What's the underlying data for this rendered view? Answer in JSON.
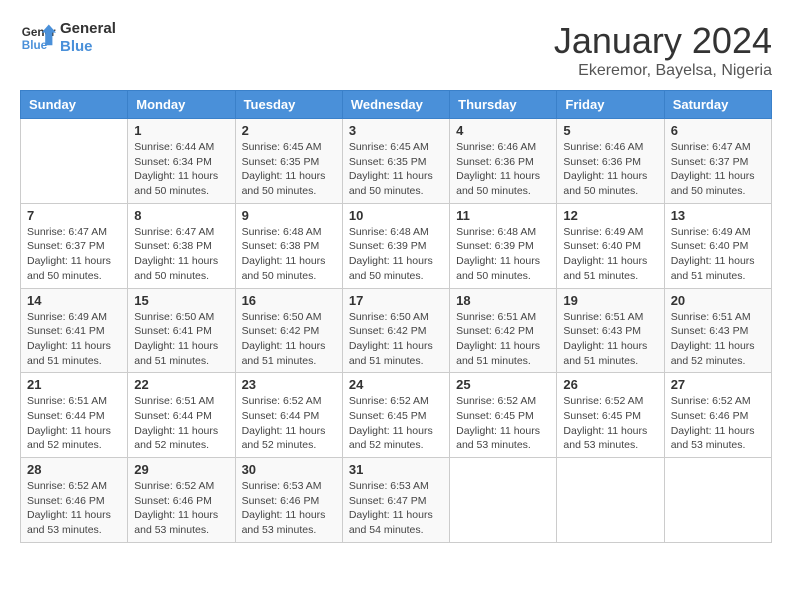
{
  "logo": {
    "text_general": "General",
    "text_blue": "Blue"
  },
  "title": "January 2024",
  "subtitle": "Ekeremor, Bayelsa, Nigeria",
  "days_header": [
    "Sunday",
    "Monday",
    "Tuesday",
    "Wednesday",
    "Thursday",
    "Friday",
    "Saturday"
  ],
  "weeks": [
    [
      {
        "num": "",
        "info": ""
      },
      {
        "num": "1",
        "info": "Sunrise: 6:44 AM\nSunset: 6:34 PM\nDaylight: 11 hours\nand 50 minutes."
      },
      {
        "num": "2",
        "info": "Sunrise: 6:45 AM\nSunset: 6:35 PM\nDaylight: 11 hours\nand 50 minutes."
      },
      {
        "num": "3",
        "info": "Sunrise: 6:45 AM\nSunset: 6:35 PM\nDaylight: 11 hours\nand 50 minutes."
      },
      {
        "num": "4",
        "info": "Sunrise: 6:46 AM\nSunset: 6:36 PM\nDaylight: 11 hours\nand 50 minutes."
      },
      {
        "num": "5",
        "info": "Sunrise: 6:46 AM\nSunset: 6:36 PM\nDaylight: 11 hours\nand 50 minutes."
      },
      {
        "num": "6",
        "info": "Sunrise: 6:47 AM\nSunset: 6:37 PM\nDaylight: 11 hours\nand 50 minutes."
      }
    ],
    [
      {
        "num": "7",
        "info": "Sunrise: 6:47 AM\nSunset: 6:37 PM\nDaylight: 11 hours\nand 50 minutes."
      },
      {
        "num": "8",
        "info": "Sunrise: 6:47 AM\nSunset: 6:38 PM\nDaylight: 11 hours\nand 50 minutes."
      },
      {
        "num": "9",
        "info": "Sunrise: 6:48 AM\nSunset: 6:38 PM\nDaylight: 11 hours\nand 50 minutes."
      },
      {
        "num": "10",
        "info": "Sunrise: 6:48 AM\nSunset: 6:39 PM\nDaylight: 11 hours\nand 50 minutes."
      },
      {
        "num": "11",
        "info": "Sunrise: 6:48 AM\nSunset: 6:39 PM\nDaylight: 11 hours\nand 50 minutes."
      },
      {
        "num": "12",
        "info": "Sunrise: 6:49 AM\nSunset: 6:40 PM\nDaylight: 11 hours\nand 51 minutes."
      },
      {
        "num": "13",
        "info": "Sunrise: 6:49 AM\nSunset: 6:40 PM\nDaylight: 11 hours\nand 51 minutes."
      }
    ],
    [
      {
        "num": "14",
        "info": "Sunrise: 6:49 AM\nSunset: 6:41 PM\nDaylight: 11 hours\nand 51 minutes."
      },
      {
        "num": "15",
        "info": "Sunrise: 6:50 AM\nSunset: 6:41 PM\nDaylight: 11 hours\nand 51 minutes."
      },
      {
        "num": "16",
        "info": "Sunrise: 6:50 AM\nSunset: 6:42 PM\nDaylight: 11 hours\nand 51 minutes."
      },
      {
        "num": "17",
        "info": "Sunrise: 6:50 AM\nSunset: 6:42 PM\nDaylight: 11 hours\nand 51 minutes."
      },
      {
        "num": "18",
        "info": "Sunrise: 6:51 AM\nSunset: 6:42 PM\nDaylight: 11 hours\nand 51 minutes."
      },
      {
        "num": "19",
        "info": "Sunrise: 6:51 AM\nSunset: 6:43 PM\nDaylight: 11 hours\nand 51 minutes."
      },
      {
        "num": "20",
        "info": "Sunrise: 6:51 AM\nSunset: 6:43 PM\nDaylight: 11 hours\nand 52 minutes."
      }
    ],
    [
      {
        "num": "21",
        "info": "Sunrise: 6:51 AM\nSunset: 6:44 PM\nDaylight: 11 hours\nand 52 minutes."
      },
      {
        "num": "22",
        "info": "Sunrise: 6:51 AM\nSunset: 6:44 PM\nDaylight: 11 hours\nand 52 minutes."
      },
      {
        "num": "23",
        "info": "Sunrise: 6:52 AM\nSunset: 6:44 PM\nDaylight: 11 hours\nand 52 minutes."
      },
      {
        "num": "24",
        "info": "Sunrise: 6:52 AM\nSunset: 6:45 PM\nDaylight: 11 hours\nand 52 minutes."
      },
      {
        "num": "25",
        "info": "Sunrise: 6:52 AM\nSunset: 6:45 PM\nDaylight: 11 hours\nand 53 minutes."
      },
      {
        "num": "26",
        "info": "Sunrise: 6:52 AM\nSunset: 6:45 PM\nDaylight: 11 hours\nand 53 minutes."
      },
      {
        "num": "27",
        "info": "Sunrise: 6:52 AM\nSunset: 6:46 PM\nDaylight: 11 hours\nand 53 minutes."
      }
    ],
    [
      {
        "num": "28",
        "info": "Sunrise: 6:52 AM\nSunset: 6:46 PM\nDaylight: 11 hours\nand 53 minutes."
      },
      {
        "num": "29",
        "info": "Sunrise: 6:52 AM\nSunset: 6:46 PM\nDaylight: 11 hours\nand 53 minutes."
      },
      {
        "num": "30",
        "info": "Sunrise: 6:53 AM\nSunset: 6:46 PM\nDaylight: 11 hours\nand 53 minutes."
      },
      {
        "num": "31",
        "info": "Sunrise: 6:53 AM\nSunset: 6:47 PM\nDaylight: 11 hours\nand 54 minutes."
      },
      {
        "num": "",
        "info": ""
      },
      {
        "num": "",
        "info": ""
      },
      {
        "num": "",
        "info": ""
      }
    ]
  ]
}
